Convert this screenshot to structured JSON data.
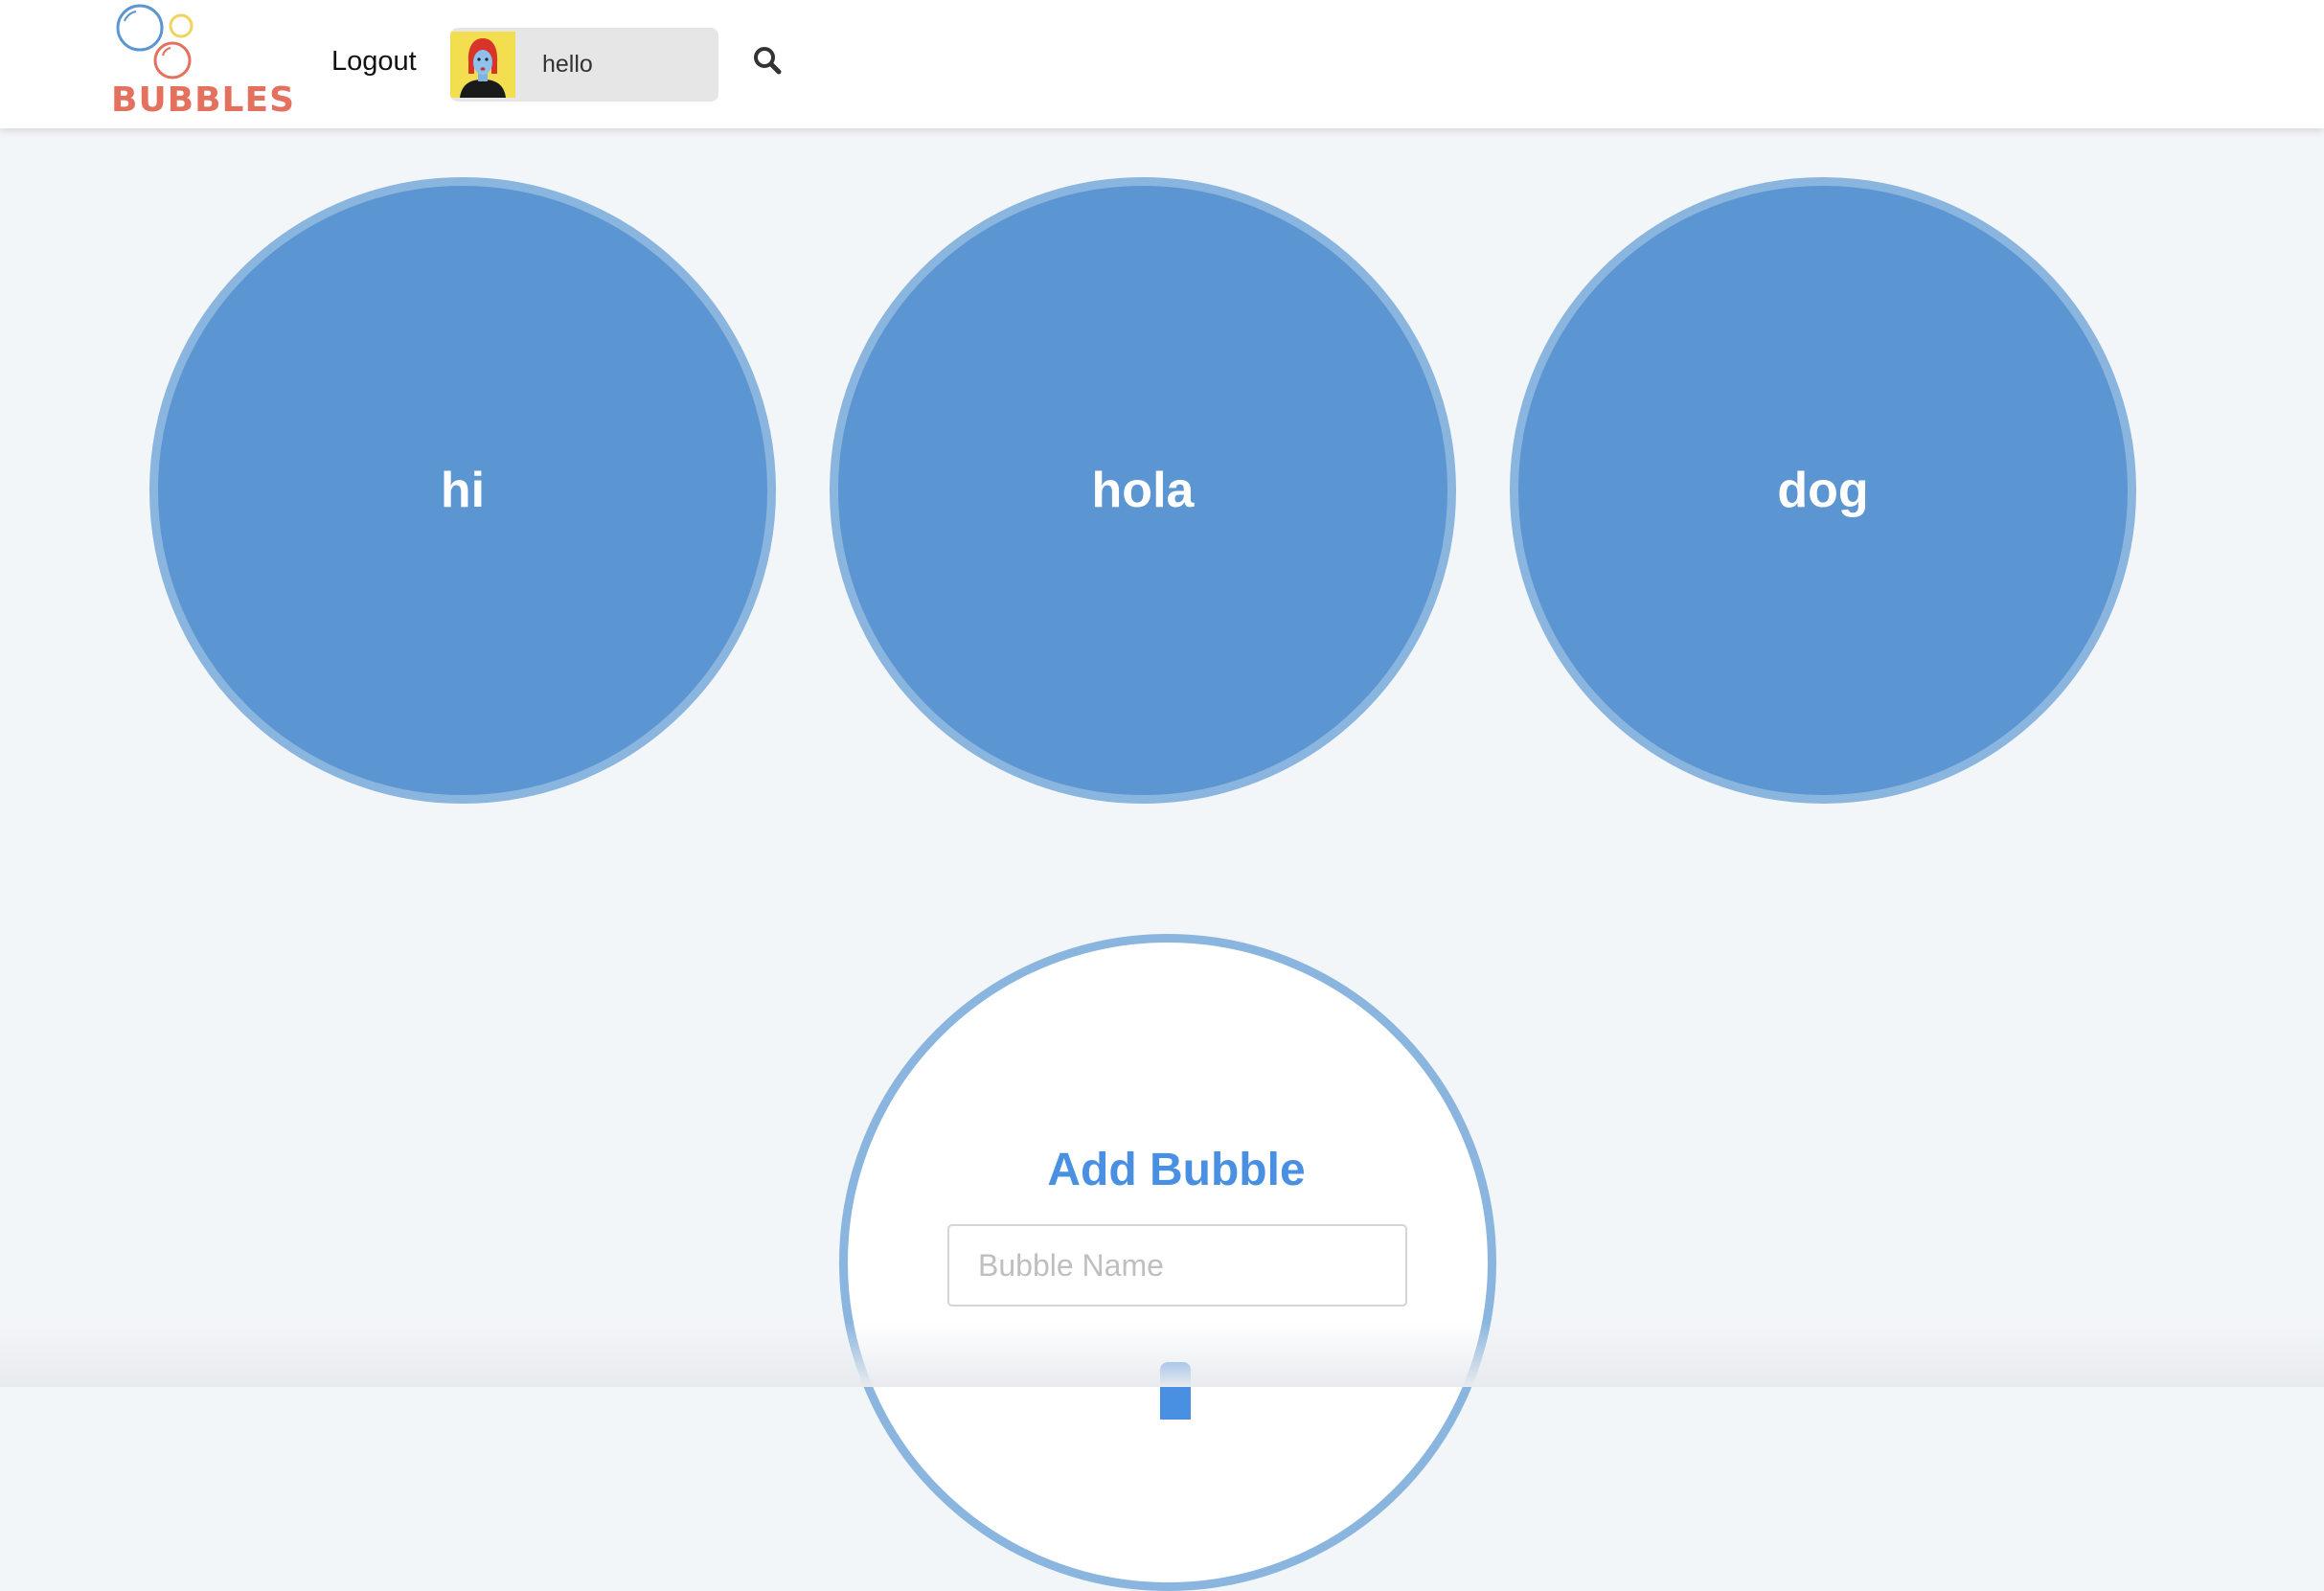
{
  "header": {
    "logo_text": "BUBBLES",
    "logout_label": "Logout",
    "profile_name": "hello",
    "search_icon": "search-icon"
  },
  "bubbles": [
    {
      "label": "hi"
    },
    {
      "label": "hola"
    },
    {
      "label": "dog"
    }
  ],
  "add_bubble": {
    "title": "Add Bubble",
    "input_placeholder": "Bubble Name",
    "input_value": ""
  },
  "colors": {
    "bubble_fill": "#5b96d3",
    "bubble_border": "#8ab5df",
    "accent": "#4a90e2",
    "logo": "#e4705e",
    "background": "#f3f6f9"
  }
}
